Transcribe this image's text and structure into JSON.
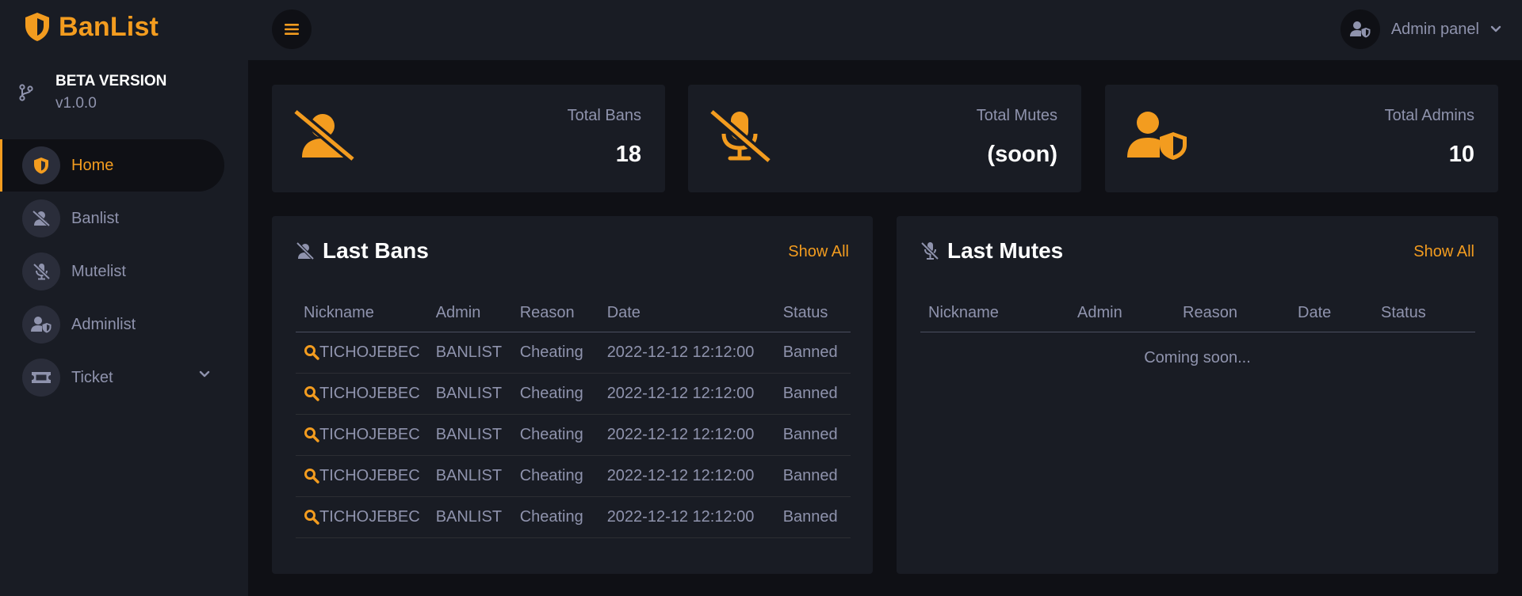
{
  "brand": {
    "name": "BanList"
  },
  "version": {
    "title": "BETA VERSION",
    "number": "v1.0.0"
  },
  "sidebar": {
    "items": [
      {
        "label": "Home",
        "icon": "shield-icon"
      },
      {
        "label": "Banlist",
        "icon": "user-slash-icon"
      },
      {
        "label": "Mutelist",
        "icon": "microphone-slash-icon"
      },
      {
        "label": "Adminlist",
        "icon": "user-shield-icon"
      },
      {
        "label": "Ticket",
        "icon": "ticket-icon"
      }
    ]
  },
  "header": {
    "profile_label": "Admin panel"
  },
  "stats": [
    {
      "label": "Total Bans",
      "value": "18",
      "icon": "user-slash-icon"
    },
    {
      "label": "Total Mutes",
      "value": "(soon)",
      "icon": "microphone-slash-icon"
    },
    {
      "label": "Total Admins",
      "value": "10",
      "icon": "user-shield-icon"
    }
  ],
  "last_bans": {
    "title": "Last Bans",
    "show_all": "Show All",
    "columns": [
      "Nickname",
      "Admin",
      "Reason",
      "Date",
      "Status"
    ],
    "rows": [
      {
        "nickname": "TICHOJEBEC",
        "admin": "BANLIST",
        "reason": "Cheating",
        "date": "2022-12-12 12:12:00",
        "status": "Banned"
      },
      {
        "nickname": "TICHOJEBEC",
        "admin": "BANLIST",
        "reason": "Cheating",
        "date": "2022-12-12 12:12:00",
        "status": "Banned"
      },
      {
        "nickname": "TICHOJEBEC",
        "admin": "BANLIST",
        "reason": "Cheating",
        "date": "2022-12-12 12:12:00",
        "status": "Banned"
      },
      {
        "nickname": "TICHOJEBEC",
        "admin": "BANLIST",
        "reason": "Cheating",
        "date": "2022-12-12 12:12:00",
        "status": "Banned"
      },
      {
        "nickname": "TICHOJEBEC",
        "admin": "BANLIST",
        "reason": "Cheating",
        "date": "2022-12-12 12:12:00",
        "status": "Banned"
      }
    ]
  },
  "last_mutes": {
    "title": "Last Mutes",
    "show_all": "Show All",
    "columns": [
      "Nickname",
      "Admin",
      "Reason",
      "Date",
      "Status"
    ],
    "empty_text": "Coming soon..."
  },
  "colors": {
    "accent": "#f39c1f",
    "background": "#0f1015",
    "card": "#191c24",
    "muted_text": "#8f93ad"
  }
}
